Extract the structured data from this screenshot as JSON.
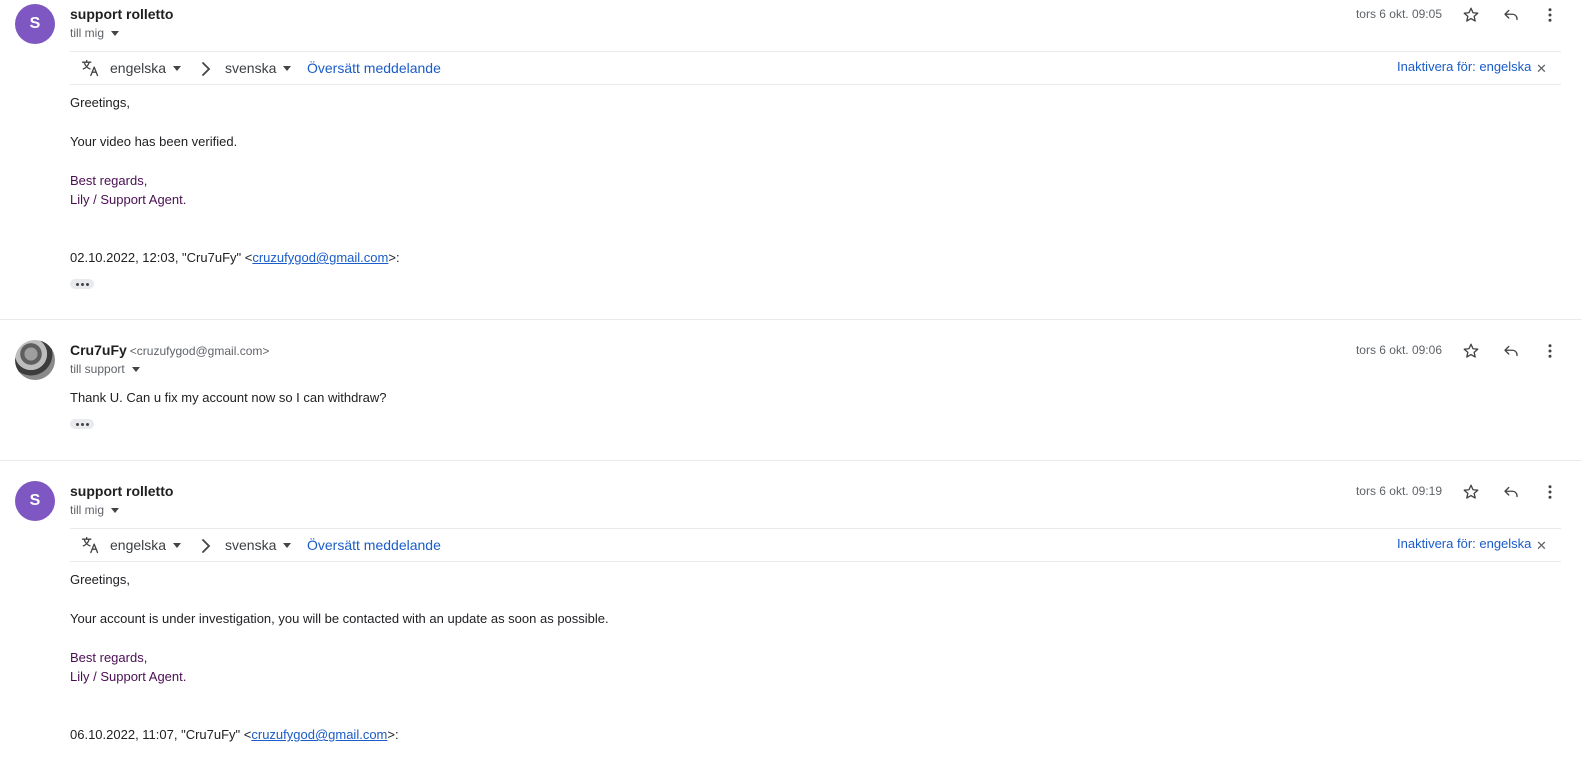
{
  "messages": [
    {
      "avatar_letter": "S",
      "sender": "support rolletto",
      "to": "till mig",
      "date": "tors 6 okt. 09:05",
      "translation": {
        "from_lang": "engelska",
        "to_lang": "svenska",
        "translate_link": "Översätt meddelande",
        "disable_link": "Inaktivera för: engelska"
      },
      "greeting": "Greetings,",
      "body": "Your video has been verified.",
      "closing": "Best regards,",
      "signature": "Lily / Support Agent.",
      "quote_prefix": "02.10.2022, 12:03, \"Cru7uFy\" <",
      "quote_email": "cruzufygod@gmail.com",
      "quote_suffix": ">:"
    },
    {
      "sender": "Cru7uFy",
      "sender_email": "<cruzufygod@gmail.com>",
      "to": "till support",
      "date": "tors 6 okt. 09:06",
      "body": "Thank U. Can u fix my account now so I can withdraw?"
    },
    {
      "avatar_letter": "S",
      "sender": "support rolletto",
      "to": "till mig",
      "date": "tors 6 okt. 09:19",
      "translation": {
        "from_lang": "engelska",
        "to_lang": "svenska",
        "translate_link": "Översätt meddelande",
        "disable_link": "Inaktivera för: engelska"
      },
      "greeting": "Greetings,",
      "body": "Your account is under investigation, you will be contacted with an update as soon as possible.",
      "closing": "Best regards,",
      "signature": "Lily / Support Agent.",
      "quote_prefix": "06.10.2022, 11:07, \"Cru7uFy\" <",
      "quote_email": "cruzufygod@gmail.com",
      "quote_suffix": ">:"
    }
  ],
  "icons": {
    "star": "star-icon",
    "reply": "reply-icon",
    "more": "more-vert-icon",
    "translate": "translate-icon",
    "chevron": "chevron-right-icon",
    "close": "close-icon"
  },
  "colors": {
    "avatar": "#7e57c2",
    "link": "#1a5cc8",
    "signature": "#4a0e53"
  }
}
